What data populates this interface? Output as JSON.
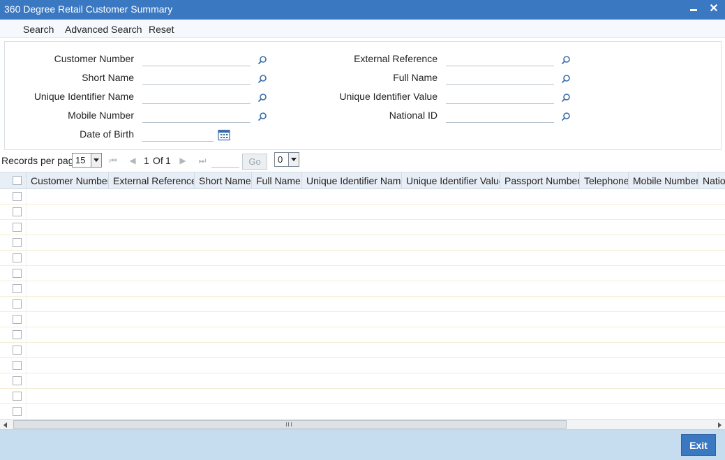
{
  "window": {
    "title": "360 Degree Retail Customer Summary",
    "minimize_icon": "minimize-icon",
    "close_icon": "close-icon"
  },
  "toolbar": {
    "search_label": "Search",
    "advanced_search_label": "Advanced Search",
    "reset_label": "Reset"
  },
  "criteria": {
    "customer_number": {
      "label": "Customer Number",
      "value": ""
    },
    "short_name": {
      "label": "Short Name",
      "value": ""
    },
    "unique_identifier_name": {
      "label": "Unique Identifier Name",
      "value": ""
    },
    "mobile_number": {
      "label": "Mobile Number",
      "value": ""
    },
    "date_of_birth": {
      "label": "Date of Birth",
      "value": ""
    },
    "external_reference": {
      "label": "External Reference",
      "value": ""
    },
    "full_name": {
      "label": "Full Name",
      "value": ""
    },
    "unique_identifier_value": {
      "label": "Unique Identifier Value",
      "value": ""
    },
    "national_id": {
      "label": "National ID",
      "value": ""
    },
    "lookup_icon": "search-icon",
    "calendar_icon": "calendar-icon"
  },
  "pager": {
    "records_per_page_label": "Records per page",
    "records_per_page_value": "15",
    "current_page": "1",
    "of_label": "Of",
    "total_pages": "1",
    "go_label": "Go",
    "go_value": "",
    "extra_select_value": "0"
  },
  "grid": {
    "columns": [
      "Customer Number",
      "External Reference",
      "Short Name",
      "Full Name",
      "Unique Identifier Name",
      "Unique Identifier Value",
      "Passport Number",
      "Telephone",
      "Mobile Number",
      "Nation"
    ],
    "row_count": 15
  },
  "footer": {
    "exit_label": "Exit"
  },
  "colors": {
    "titlebar": "#3b78c2",
    "footer": "#c6dcef",
    "header_row": "#e8eef6"
  }
}
